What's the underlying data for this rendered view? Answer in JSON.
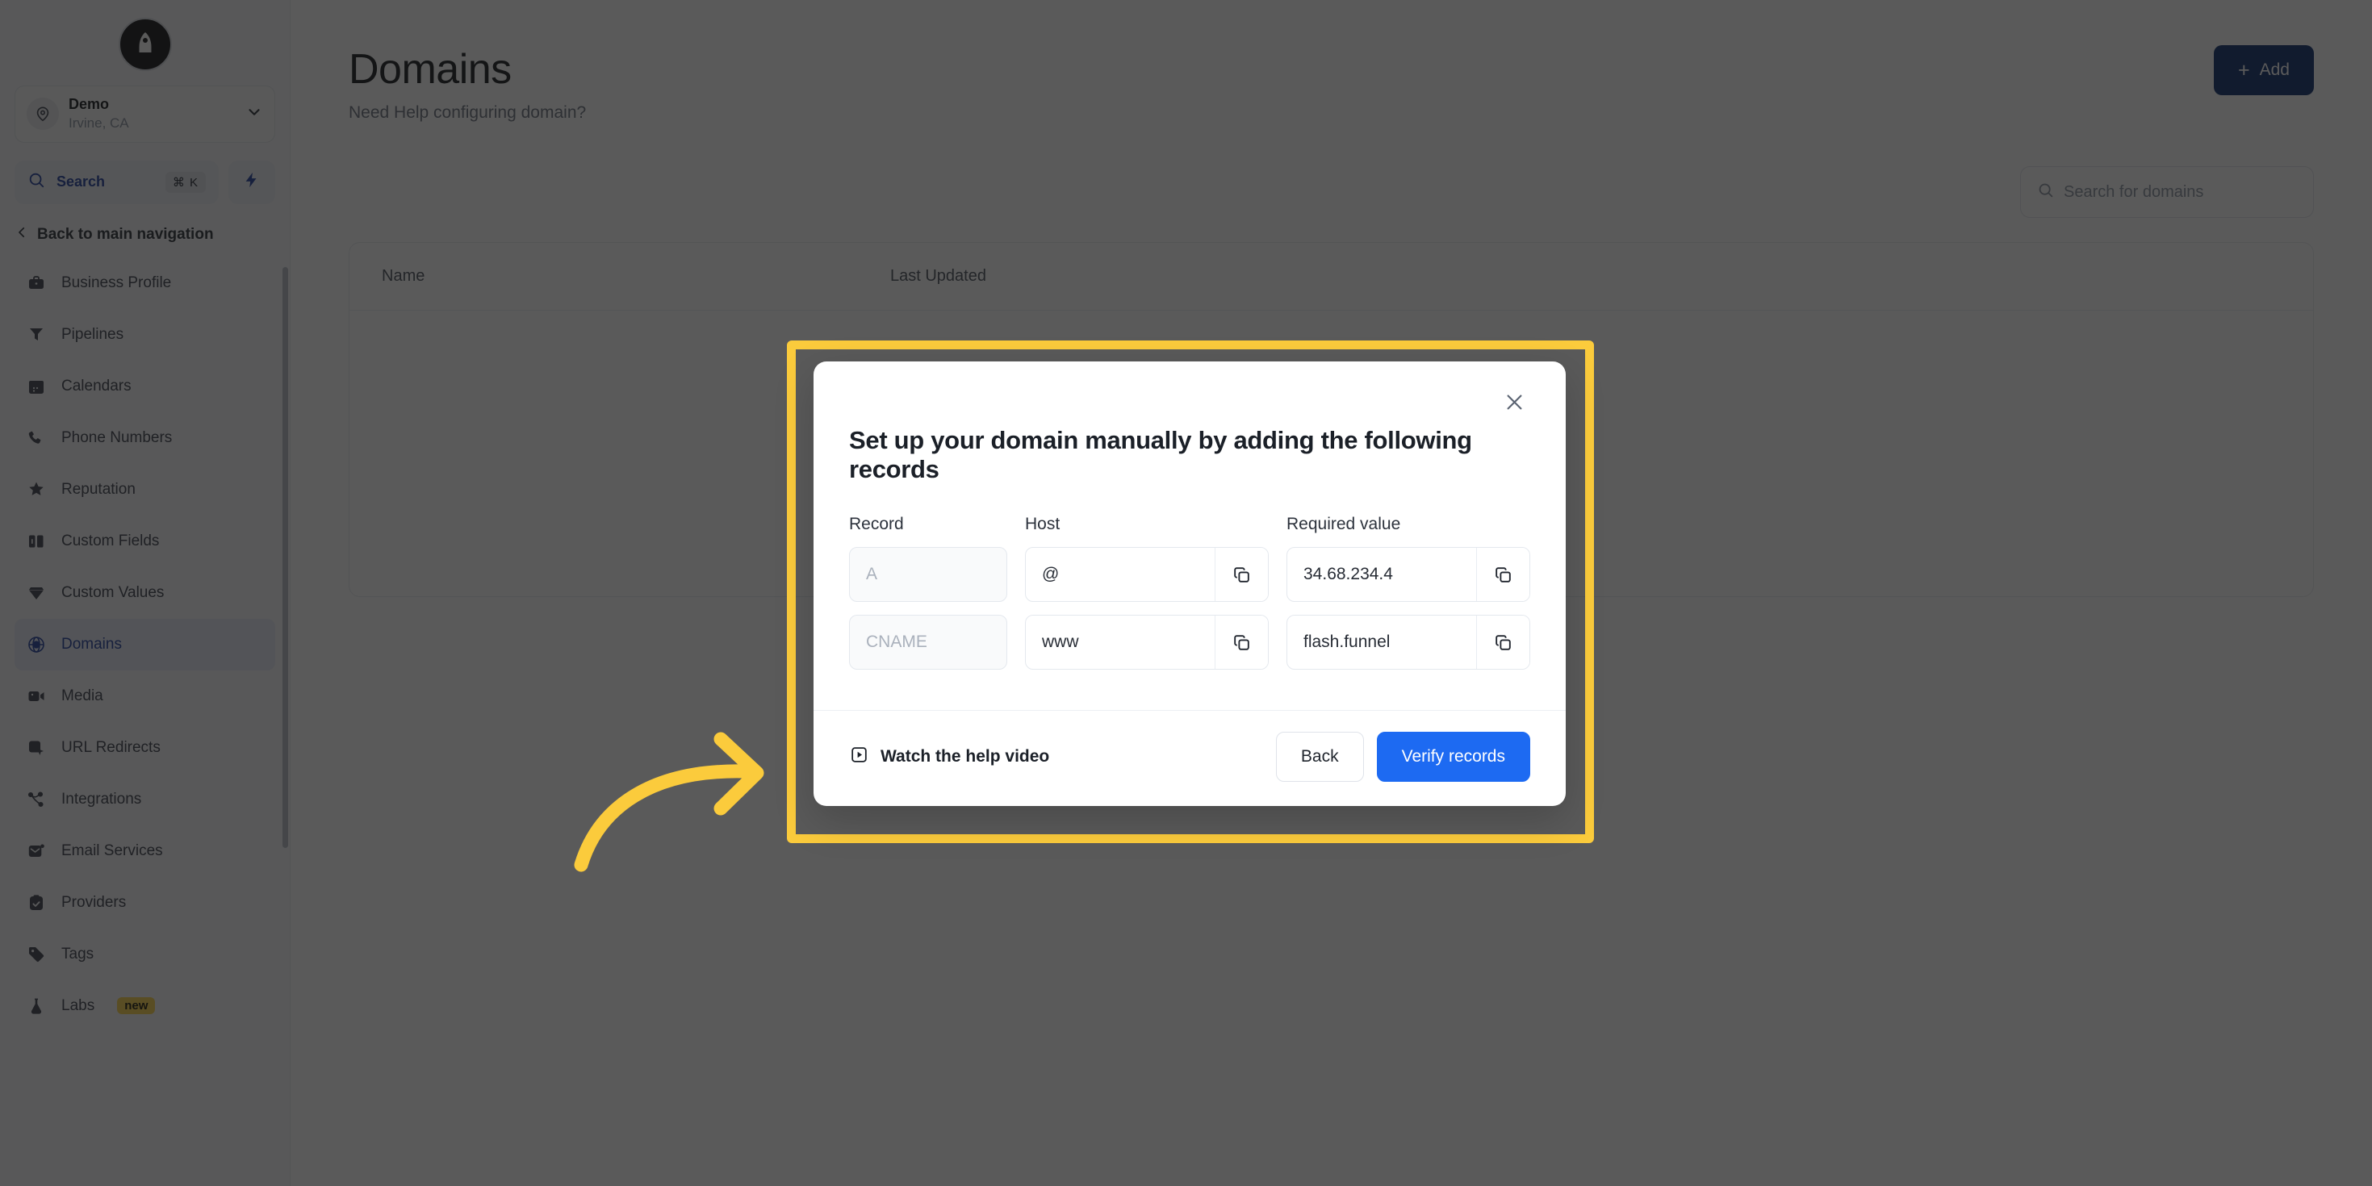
{
  "sidebar": {
    "logo_icon": "rocket-logo-icon",
    "account": {
      "icon": "location-pin-icon",
      "name": "Demo",
      "location": "Irvine, CA",
      "chevron_icon": "chevron-down-icon"
    },
    "search": {
      "icon": "search-icon",
      "label": "Search",
      "shortcut": "⌘ K",
      "bolt_icon": "lightning-bolt-icon"
    },
    "back_nav": {
      "icon": "chevron-left-icon",
      "label": "Back to main navigation"
    },
    "items": [
      {
        "label": "Business Profile",
        "icon": "briefcase-icon",
        "active": false
      },
      {
        "label": "Pipelines",
        "icon": "funnel-icon",
        "active": false
      },
      {
        "label": "Calendars",
        "icon": "calendar-icon",
        "active": false
      },
      {
        "label": "Phone Numbers",
        "icon": "phone-icon",
        "active": false
      },
      {
        "label": "Reputation",
        "icon": "star-icon",
        "active": false
      },
      {
        "label": "Custom Fields",
        "icon": "columns-icon",
        "active": false
      },
      {
        "label": "Custom Values",
        "icon": "gem-icon",
        "active": false
      },
      {
        "label": "Domains",
        "icon": "globe-icon",
        "active": true
      },
      {
        "label": "Media",
        "icon": "video-icon",
        "active": false
      },
      {
        "label": "URL Redirects",
        "icon": "cursor-box-icon",
        "active": false
      },
      {
        "label": "Integrations",
        "icon": "nodes-icon",
        "active": false
      },
      {
        "label": "Email Services",
        "icon": "envelope-icon",
        "active": false
      },
      {
        "label": "Providers",
        "icon": "clipboard-check-icon",
        "active": false
      },
      {
        "label": "Tags",
        "icon": "tag-icon",
        "active": false
      },
      {
        "label": "Labs",
        "icon": "flask-icon",
        "active": false,
        "badge": "new"
      }
    ]
  },
  "main": {
    "title": "Domains",
    "subtitle": "Need Help configuring domain?",
    "add_button": {
      "label": "Add",
      "icon": "plus-icon"
    },
    "search": {
      "placeholder": "Search for domains",
      "icon": "search-icon"
    },
    "table": {
      "columns": [
        "Name",
        "Last Updated"
      ]
    }
  },
  "modal": {
    "close_icon": "close-icon",
    "title": "Set up your domain manually by adding the following records",
    "column_labels": [
      "Record",
      "Host",
      "Required value"
    ],
    "rows": [
      {
        "record": "A",
        "host": "@",
        "value": "34.68.234.4",
        "copy_icon": "copy-icon"
      },
      {
        "record": "CNAME",
        "host": "www",
        "value": "flash.funnel",
        "copy_icon": "copy-icon"
      }
    ],
    "footer": {
      "help_video": {
        "label": "Watch the help video",
        "icon": "play-square-icon"
      },
      "back_label": "Back",
      "verify_label": "Verify records"
    }
  },
  "annotation": {
    "arrow_icon": "curved-arrow-icon",
    "color": "#fbcb3c"
  },
  "colors": {
    "highlight": "#fbcb3c",
    "primary_blue": "#1d6af2",
    "nav_active": "#1f3f9e",
    "add_button": "#0d2d6b",
    "badge_new": "#fbd34a"
  }
}
